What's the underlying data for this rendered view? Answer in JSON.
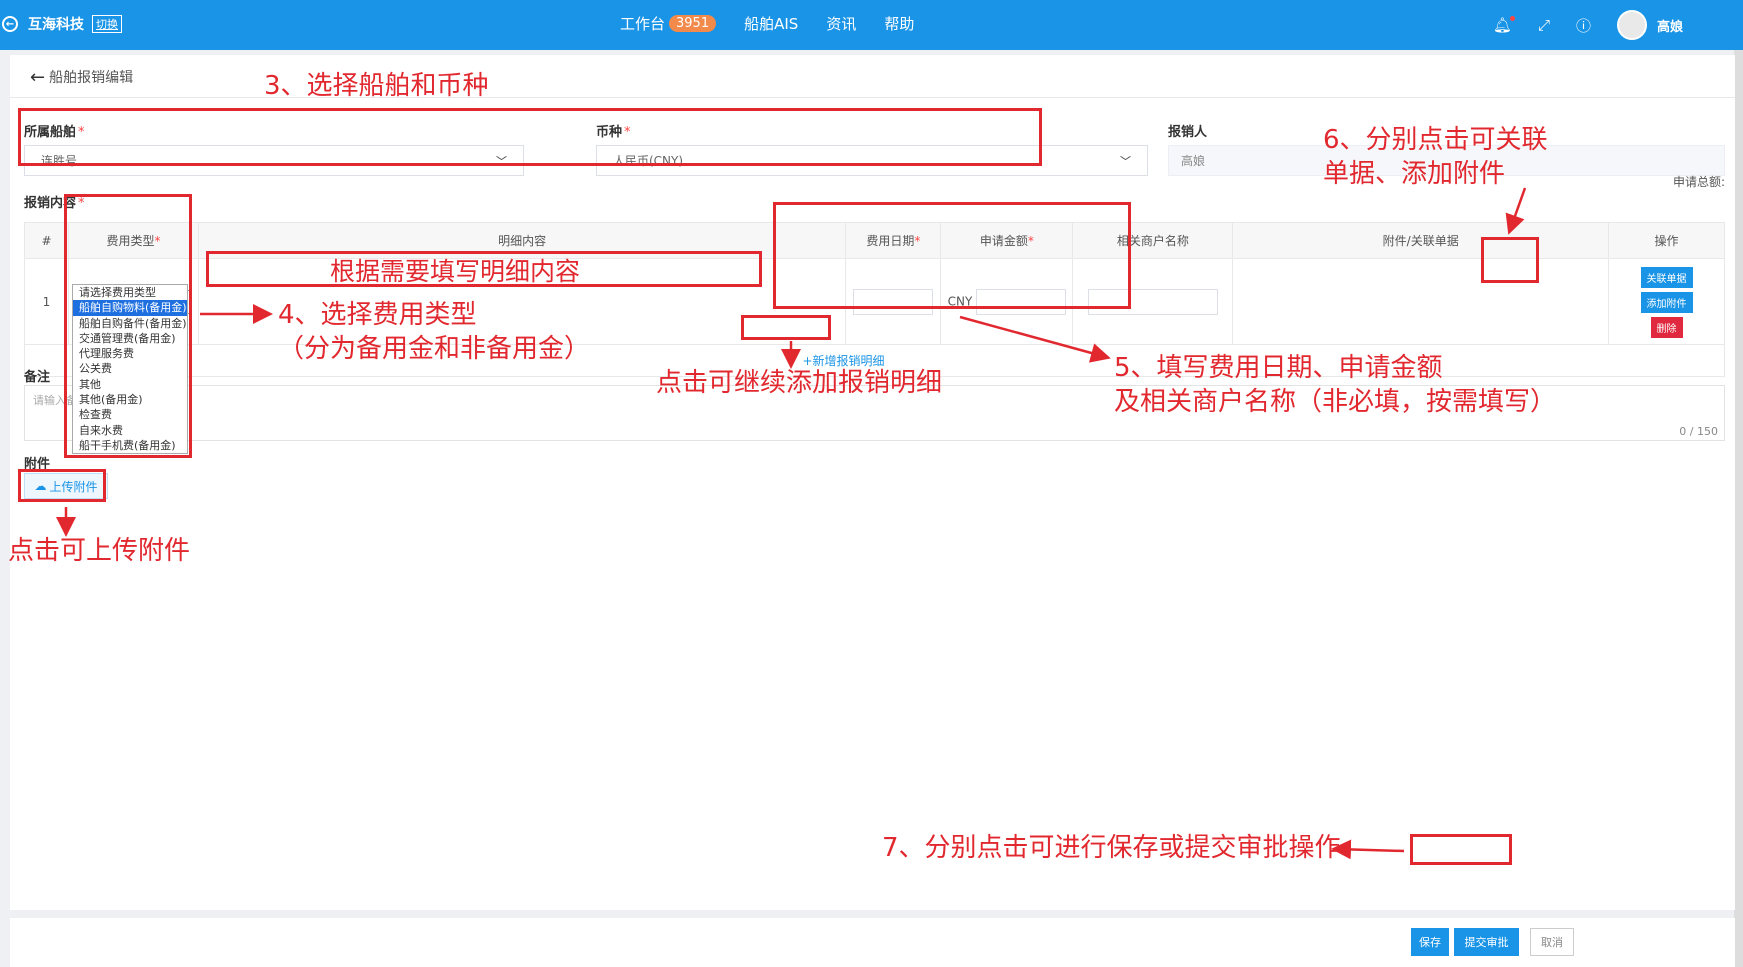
{
  "topbar": {
    "brand": "互海科技",
    "brand_badge": "切换",
    "nav": [
      {
        "label": "工作台",
        "badge": "3951"
      },
      {
        "label": "船舶AIS"
      },
      {
        "label": "资讯"
      },
      {
        "label": "帮助"
      }
    ],
    "username": "高娘"
  },
  "page": {
    "back_title": "船舶报销编辑"
  },
  "form": {
    "vessel_label": "所属船舶",
    "vessel_value": "连胜号",
    "currency_label": "币种",
    "currency_value": "人民币(CNY)",
    "claimant_label": "报销人",
    "claimant_value": "高娘",
    "content_label": "报销内容",
    "total_label": "申请总额:",
    "remark_label": "备注",
    "remark_placeholder": "请输入备注",
    "remark_counter": "0 / 150",
    "attach_label": "附件",
    "upload_label": "上传附件"
  },
  "table": {
    "headers": [
      "#",
      "费用类型",
      "明细内容",
      "费用日期",
      "申请金额",
      "相关商户名称",
      "附件/关联单据",
      "操作"
    ],
    "rows": [
      {
        "index": "1",
        "expense_type": "船舶自购物料(备",
        "currency": "CNY"
      }
    ],
    "link_button": "关联单据",
    "attach_button": "添加附件",
    "delete_button": "删除",
    "add_row": "+新增报销明细"
  },
  "dropdown_options": [
    "请选择费用类型",
    "船舶自购物料(备用金)",
    "船舶自购备件(备用金)",
    "交通管理费(备用金)",
    "代理服务费",
    "公关费",
    "其他",
    "其他(备用金)",
    "检查费",
    "自来水费",
    "船干手机费(备用金)"
  ],
  "dropdown_selected_index": 1,
  "footer": {
    "save": "保存",
    "submit": "提交审批",
    "cancel": "取消"
  },
  "annotations": {
    "step3": "3、选择船舶和币种",
    "detail": "根据需要填写明细内容",
    "step4a": "4、选择费用类型",
    "step4b": "（分为备用金和非备用金）",
    "add_more": "点击可继续添加报销明细",
    "step5a": "5、填写费用日期、申请金额",
    "step5b": "及相关商户名称（非必填，按需填写）",
    "step6a": "6、分别点击可关联",
    "step6b": "单据、添加附件",
    "upload_tip": "点击可上传附件",
    "step7": "7、分别点击可进行保存或提交审批操作"
  }
}
